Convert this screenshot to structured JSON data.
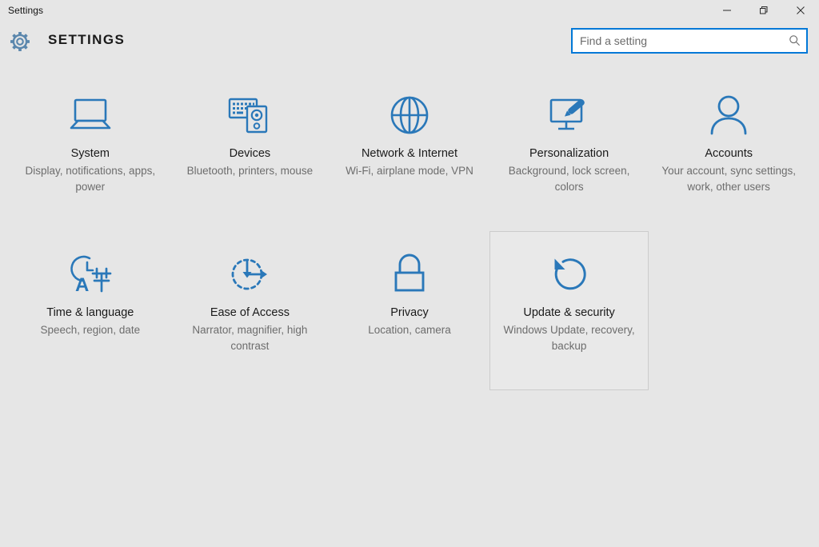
{
  "window": {
    "title": "Settings",
    "controls": [
      {
        "name": "minimize",
        "label": "—"
      },
      {
        "name": "restore",
        "label": "❐"
      },
      {
        "name": "close",
        "label": "✕"
      }
    ]
  },
  "header": {
    "app_title": "SETTINGS",
    "gear_icon": "gear-icon"
  },
  "search": {
    "placeholder": "Find a setting",
    "value": "",
    "icon": "search-icon"
  },
  "colors": {
    "accent": "#0078d7",
    "icon_blue": "#2a78b9",
    "background": "#e6e6e6",
    "title_text": "#1a1a1a",
    "subtitle_text": "#6d6d6d",
    "tile_border": "#cccccc"
  },
  "categories": [
    {
      "id": "system",
      "title": "System",
      "subtitle": "Display, notifications, apps, power",
      "icon": "laptop-icon",
      "active": false
    },
    {
      "id": "devices",
      "title": "Devices",
      "subtitle": "Bluetooth, printers, mouse",
      "icon": "keyboard-speaker-icon",
      "active": false
    },
    {
      "id": "network-internet",
      "title": "Network & Internet",
      "subtitle": "Wi-Fi, airplane mode, VPN",
      "icon": "globe-icon",
      "active": false
    },
    {
      "id": "personalization",
      "title": "Personalization",
      "subtitle": "Background, lock screen, colors",
      "icon": "monitor-brush-icon",
      "active": false
    },
    {
      "id": "accounts",
      "title": "Accounts",
      "subtitle": "Your account, sync settings, work, other users",
      "icon": "person-icon",
      "active": false
    },
    {
      "id": "time-language",
      "title": "Time & language",
      "subtitle": "Speech, region, date",
      "icon": "clock-language-icon",
      "active": false
    },
    {
      "id": "ease-of-access",
      "title": "Ease of Access",
      "subtitle": "Narrator, magnifier, high contrast",
      "icon": "accessibility-arrows-icon",
      "active": false
    },
    {
      "id": "privacy",
      "title": "Privacy",
      "subtitle": "Location, camera",
      "icon": "lock-icon",
      "active": false
    },
    {
      "id": "update-security",
      "title": "Update & security",
      "subtitle": "Windows Update, recovery, backup",
      "icon": "refresh-circle-icon",
      "active": true
    }
  ]
}
